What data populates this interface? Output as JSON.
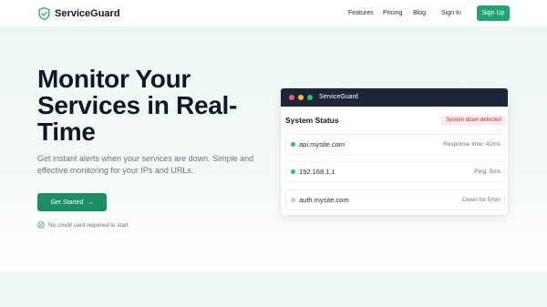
{
  "nav": {
    "brand": "ServiceGuard",
    "links": [
      "Features",
      "Pricing",
      "Blog"
    ],
    "signin": "Sign In",
    "signup": "Sign Up"
  },
  "hero": {
    "headline": "Monitor Your Services in Real-Time",
    "subtext": "Get instant alerts when your services are down. Simple and effective monitoring for your IPs and URLs.",
    "cta": "Get Started",
    "cta_arrow": "→",
    "note": "No credit card required to start"
  },
  "card": {
    "window_title": "ServiceGuard",
    "status_title": "System Status",
    "alert": "System down detected",
    "services": [
      {
        "host": "api.mysite.com",
        "meta": "Response time: 42ms",
        "status": "up"
      },
      {
        "host": "192.168.1.1",
        "meta": "Ping: 5ms",
        "status": "up"
      },
      {
        "host": "auth.mysite.com",
        "meta": "Down for 5min",
        "status": "down"
      }
    ]
  },
  "colors": {
    "brand_green": "#1ea672",
    "cta_green": "#1b8f63",
    "status_up": "#22c55e",
    "status_down": "#f4b4b4",
    "alert_red": "#dc2626"
  },
  "icons": {
    "brand": "shield-check-icon",
    "note": "check-circle-icon",
    "window_controls": [
      "close-dot-icon",
      "minimize-dot-icon",
      "maximize-dot-icon"
    ]
  }
}
